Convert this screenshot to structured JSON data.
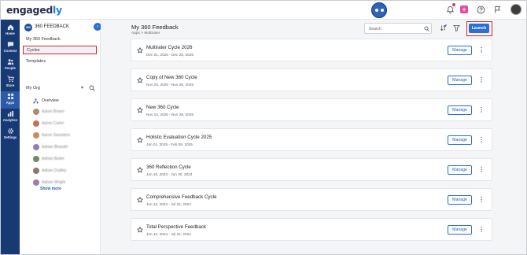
{
  "app": {
    "logo_main": "engaged",
    "logo_accent": "ly"
  },
  "rail": [
    {
      "label": "Home",
      "icon": "home-icon"
    },
    {
      "label": "Connect",
      "icon": "chat-icon"
    },
    {
      "label": "People",
      "icon": "people-icon"
    },
    {
      "label": "Store",
      "icon": "cart-icon"
    },
    {
      "label": "Apps",
      "icon": "grid-icon",
      "active": true
    },
    {
      "label": "Analytics",
      "icon": "chart-icon"
    },
    {
      "label": "Settings",
      "icon": "gear-icon"
    }
  ],
  "sidebar": {
    "module_icon_text": "360",
    "module_title": "360 FEEDBACK",
    "collapse_glyph": "‹",
    "items": [
      {
        "label": "My 360 Feedback"
      },
      {
        "label": "Cycles",
        "active": true
      },
      {
        "label": "Templates"
      }
    ],
    "org_label": "My Org",
    "org_caret": "▾",
    "overview_label": "Overview",
    "members": [
      {
        "name": "Aaron Brown",
        "color": "#b08a6a"
      },
      {
        "name": "Aaron Carter",
        "color": "#c1705a"
      },
      {
        "name": "Aaron Saunders",
        "color": "#d08a5a"
      },
      {
        "name": "Adrian Bharath",
        "color": "#9a7ab8"
      },
      {
        "name": "Adrian Butler",
        "color": "#6a8a6a"
      },
      {
        "name": "Adrian Dudley",
        "color": "#8a7a6a"
      },
      {
        "name": "Adrian Wright",
        "color": "#a07ab0"
      }
    ],
    "show_more": "Show more"
  },
  "main": {
    "title": "My 360 Feedback",
    "breadcrumb": "Apps  >  Multirater",
    "search_placeholder": "Search",
    "launch_label": "Launch",
    "manage_label": "Manage",
    "kebab_glyph": "⋮",
    "cycles": [
      {
        "name": "Multirater Cycle 2026",
        "dates": "Dec 01, 2025 - Dec 25, 2025"
      },
      {
        "name": "Copy of New 360 Cycle",
        "dates": "Nov 24, 2025 - Nov 26, 2025"
      },
      {
        "name": "New 360 Cycle",
        "dates": "Nov 24, 2025 - Nov 28, 2025"
      },
      {
        "name": "Holistic Evaluation Cycle 2025",
        "dates": "Jan 01, 2025 - Feb 08, 2025"
      },
      {
        "name": "360 Reflection Cycle",
        "dates": "Jun 10, 2024 - Jun 30, 2024"
      },
      {
        "name": "Comprehensive Feedback Cycle",
        "dates": "Jun 10, 2024 - Jul 24, 2024"
      },
      {
        "name": "Total Perspective Feedback",
        "dates": "Jun 10, 2024 - Jul 24, 2024"
      }
    ]
  },
  "colors": {
    "rail": "#183a74",
    "accent": "#2a6fd6",
    "highlight": "#d42530"
  }
}
